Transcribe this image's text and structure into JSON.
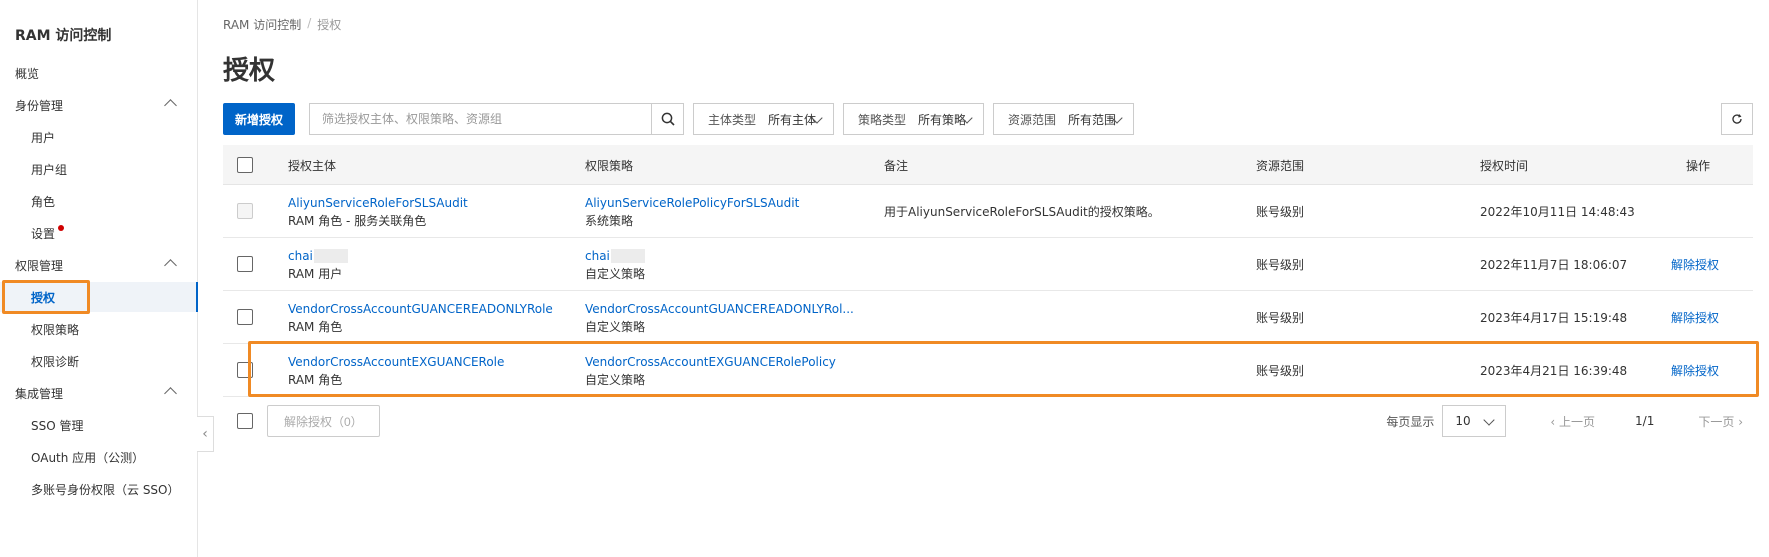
{
  "sidebar": {
    "title": "RAM 访问控制",
    "items": [
      {
        "label": "概览"
      },
      {
        "label": "身份管理"
      },
      {
        "label": "用户"
      },
      {
        "label": "用户组"
      },
      {
        "label": "角色"
      },
      {
        "label": "设置"
      },
      {
        "label": "权限管理"
      },
      {
        "label": "授权"
      },
      {
        "label": "权限策略"
      },
      {
        "label": "权限诊断"
      },
      {
        "label": "集成管理"
      },
      {
        "label": "SSO 管理"
      },
      {
        "label": "OAuth 应用（公测）"
      },
      {
        "label": "多账号身份权限（云 SSO）"
      }
    ]
  },
  "breadcrumb": {
    "root": "RAM 访问控制",
    "current": "授权"
  },
  "page_title": "授权",
  "toolbar": {
    "new_button": "新增授权",
    "search_placeholder": "筛选授权主体、权限策略、资源组",
    "filters": [
      {
        "label": "主体类型",
        "value": "所有主体"
      },
      {
        "label": "策略类型",
        "value": "所有策略"
      },
      {
        "label": "资源范围",
        "value": "所有范围"
      }
    ]
  },
  "table": {
    "headers": [
      "授权主体",
      "权限策略",
      "备注",
      "资源范围",
      "授权时间",
      "操作"
    ],
    "rows": [
      {
        "principal": "AliyunServiceRoleForSLSAudit",
        "principal_type": "RAM 角色 - 服务关联角色",
        "policy": "AliyunServiceRolePolicyForSLSAudit",
        "policy_type": "系统策略",
        "note": "用于AliyunServiceRoleForSLSAudit的授权策略。",
        "scope": "账号级别",
        "time": "2022年10月11日 14:48:43",
        "action": ""
      },
      {
        "principal": "chai",
        "principal_type": "RAM 用户",
        "policy": "chai",
        "policy_type": "自定义策略",
        "note": "",
        "scope": "账号级别",
        "time": "2022年11月7日 18:06:07",
        "action": "解除授权"
      },
      {
        "principal": "VendorCrossAccountGUANCEREADONLYRole",
        "principal_type": "RAM 角色",
        "policy": "VendorCrossAccountGUANCEREADONLYRol...",
        "policy_type": "自定义策略",
        "note": "",
        "scope": "账号级别",
        "time": "2023年4月17日 15:19:48",
        "action": "解除授权"
      },
      {
        "principal": "VendorCrossAccountEXGUANCERole",
        "principal_type": "RAM 角色",
        "policy": "VendorCrossAccountEXGUANCERolePolicy",
        "policy_type": "自定义策略",
        "note": "",
        "scope": "账号级别",
        "time": "2023年4月21日 16:39:48",
        "action": "解除授权"
      }
    ]
  },
  "footer": {
    "revoke_button": "解除授权（0）",
    "page_size_label": "每页显示",
    "page_size": "10",
    "prev": "上一页",
    "page": "1/1",
    "next": "下一页"
  },
  "colors": {
    "accent": "#0064c8",
    "highlight": "#f08a24",
    "badge": "#d00000"
  }
}
